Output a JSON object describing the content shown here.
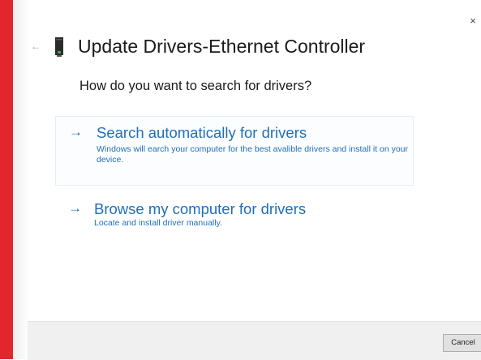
{
  "dialog": {
    "title": "Update Drivers-Ethernet Controller",
    "question": "How do you want to search for drivers?",
    "close_glyph": "×",
    "back_glyph": "←",
    "options": [
      {
        "arrow": "→",
        "title": "Search automatically for drivers",
        "description": "Windows will earch your computer for the best avalible drivers and install it on your device."
      },
      {
        "arrow": "→",
        "title": "Browse my computer for drivers",
        "description": "Locate and install driver manually."
      }
    ],
    "cancel_label": "Cancel"
  },
  "colors": {
    "accent": "#1e6fb8",
    "side_strip": "#e3262d",
    "footer_bg": "#f0f0f0"
  },
  "icons": {
    "device": "network-adapter-icon",
    "back": "back-arrow-icon",
    "close": "close-icon",
    "option_arrow": "arrow-right-icon"
  }
}
